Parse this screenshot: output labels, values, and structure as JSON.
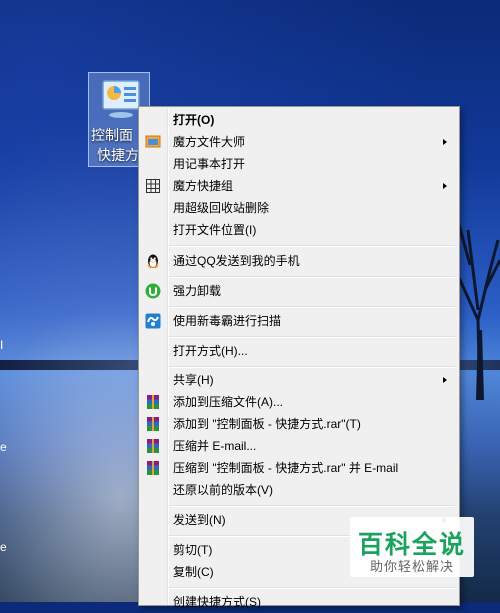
{
  "desktop": {
    "icon_label_line1": "控制面",
    "icon_label_line2": "快捷方",
    "edge_marks": [
      "I",
      "e",
      "e"
    ]
  },
  "menu": {
    "items": [
      {
        "label": "打开(O)",
        "bold": true
      },
      {
        "label": "魔方文件大师",
        "icon": "cube-master-icon",
        "submenu": true
      },
      {
        "label": "用记事本打开"
      },
      {
        "label": "魔方快捷组",
        "icon": "grid-icon",
        "submenu": true
      },
      {
        "label": "用超级回收站删除"
      },
      {
        "label": "打开文件位置(I)"
      },
      {
        "label": "通过QQ发送到我的手机",
        "icon": "qq-penguin-icon"
      },
      {
        "label": "强力卸载",
        "icon": "green-uninstall-icon"
      },
      {
        "label": "使用新毒霸进行扫描",
        "icon": "duba-shield-icon"
      },
      {
        "label": "打开方式(H)..."
      },
      {
        "label": "共享(H)",
        "submenu": true
      },
      {
        "label": "添加到压缩文件(A)...",
        "icon": "winrar-icon"
      },
      {
        "label": "添加到 \"控制面板 - 快捷方式.rar\"(T)",
        "icon": "winrar-icon"
      },
      {
        "label": "压缩并 E-mail...",
        "icon": "winrar-icon"
      },
      {
        "label": "压缩到 \"控制面板 - 快捷方式.rar\" 并 E-mail",
        "icon": "winrar-icon"
      },
      {
        "label": "还原以前的版本(V)"
      },
      {
        "label": "发送到(N)",
        "submenu": true
      },
      {
        "label": "剪切(T)"
      },
      {
        "label": "复制(C)"
      },
      {
        "label": "创建快捷方式(S)"
      }
    ]
  },
  "watermark": {
    "title": "百科全说",
    "subtitle": "助你轻松解决"
  },
  "colors": {
    "menu_bg": "#f0f0f0",
    "watermark_green": "#1aa25e"
  }
}
